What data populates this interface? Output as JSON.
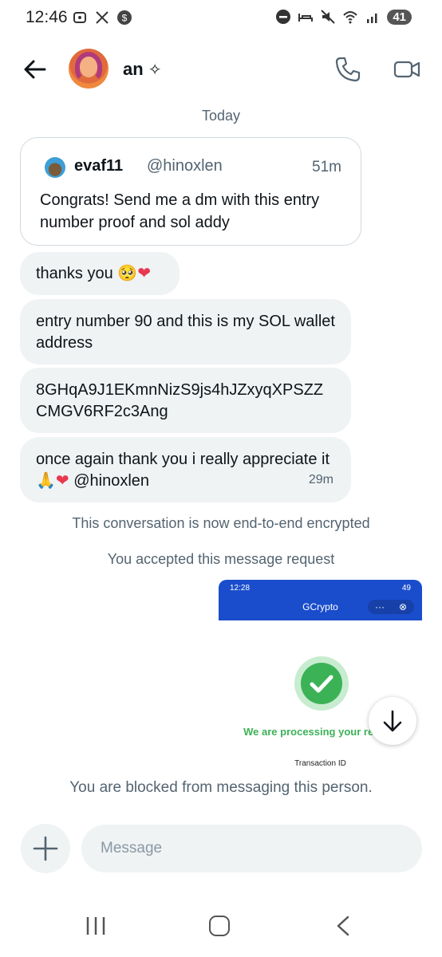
{
  "status_bar": {
    "time": "12:46",
    "battery": "41",
    "left_icons": [
      "screenshot-icon",
      "x-app-icon",
      "dollar-circle-icon"
    ],
    "right_icons": [
      "do-not-disturb-icon",
      "sleep-mode-icon",
      "mute-icon",
      "wifi-icon",
      "signal-icon"
    ]
  },
  "header": {
    "contact_name": "an",
    "name_decoration": "✧",
    "icons": [
      "back-arrow-icon",
      "phone-icon",
      "video-camera-icon"
    ]
  },
  "conversation": {
    "day_label": "Today",
    "quoted_post": {
      "author_name": "evaf11",
      "author_handle": "@hinoxlen",
      "time": "51m",
      "text": "Congrats! Send me a dm with this entry number proof and sol addy"
    },
    "messages": [
      {
        "text": "thanks you 🥺",
        "emoji_heart": "❤"
      },
      {
        "text": "entry number 90 and this is my SOL wallet address"
      },
      {
        "text": "8GHqA9J1EKmnNizS9js4hJZxyqXPSZZ CMGV6RF2c3Ang"
      },
      {
        "text": "once again thank you i really appreciate it 🙏",
        "emoji_heart": "❤",
        "mention": "@hinoxlen",
        "time": "29m"
      }
    ],
    "system_notices": [
      "This conversation is now end-to-end encrypted",
      "You accepted this message request"
    ],
    "image_message": {
      "status_time": "12:28",
      "status_battery": "49",
      "app_title": "GCrypto",
      "menu_dots": "···",
      "close_symbol": "⊗",
      "processing_text": "We are processing your request",
      "transaction_label": "Transaction ID"
    },
    "blocked_notice": "You are blocked from messaging this person."
  },
  "composer": {
    "placeholder": "Message",
    "value": ""
  },
  "colors": {
    "accent_blue": "#1a4dcc",
    "success_green": "#3cb257",
    "bubble_bg": "#eff3f4",
    "secondary_text": "#536471"
  }
}
